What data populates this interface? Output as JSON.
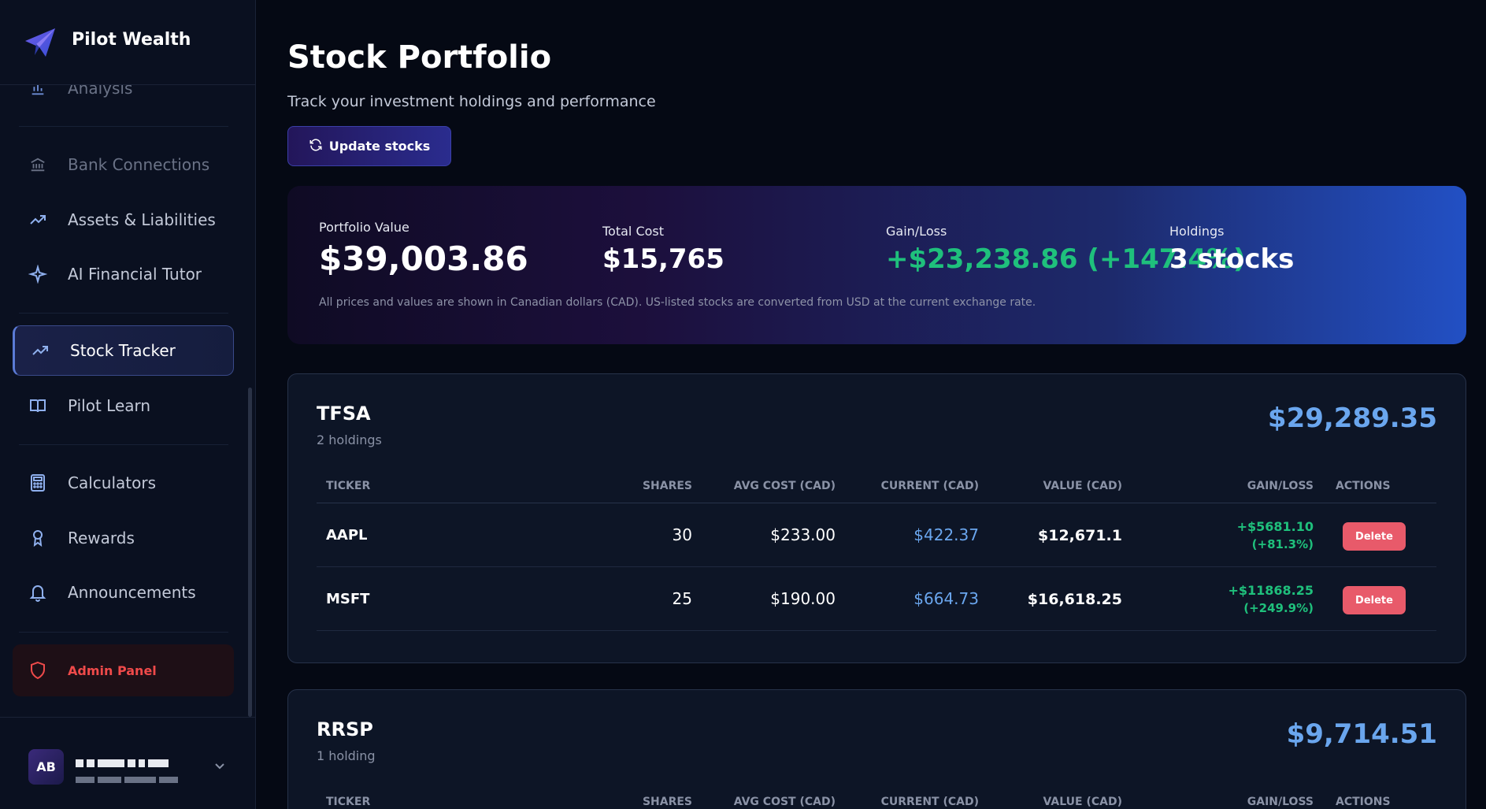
{
  "brand": {
    "name": "Pilot Wealth"
  },
  "sidebar": {
    "items": [
      {
        "label": "Analysis",
        "icon": "bar-chart-icon"
      },
      {
        "label": "Bank Connections",
        "icon": "bank-icon"
      },
      {
        "label": "Assets & Liabilities",
        "icon": "trending-up-icon"
      },
      {
        "label": "AI Financial Tutor",
        "icon": "sparkle-icon"
      },
      {
        "label": "Stock Tracker",
        "icon": "trending-up-icon"
      },
      {
        "label": "Pilot Learn",
        "icon": "book-icon"
      },
      {
        "label": "Calculators",
        "icon": "calculator-icon"
      },
      {
        "label": "Rewards",
        "icon": "award-icon"
      },
      {
        "label": "Announcements",
        "icon": "bell-icon"
      },
      {
        "label": "Admin Panel",
        "icon": "shield-icon"
      }
    ],
    "user": {
      "initials": "AB"
    }
  },
  "header": {
    "title": "Stock Portfolio",
    "subtitle": "Track your investment holdings and performance",
    "update_label": "Update stocks"
  },
  "summary": {
    "portfolio_value_label": "Portfolio Value",
    "portfolio_value": "$39,003.86",
    "total_cost_label": "Total Cost",
    "total_cost": "$15,765",
    "gain_loss_label": "Gain/Loss",
    "gain_loss": "+$23,238.86 (+147.4%)",
    "holdings_label": "Holdings",
    "holdings": "3 stocks",
    "note": "All prices and values are shown in Canadian dollars (CAD). US-listed stocks are converted from USD at the current exchange rate."
  },
  "columns": [
    "TICKER",
    "SHARES",
    "AVG COST (CAD)",
    "CURRENT (CAD)",
    "VALUE (CAD)",
    "GAIN/LOSS",
    "ACTIONS"
  ],
  "accounts": [
    {
      "name": "TFSA",
      "count": "2 holdings",
      "total": "$29,289.35",
      "rows": [
        {
          "ticker": "AAPL",
          "shares": "30",
          "avg_cost": "$233.00",
          "current": "$422.37",
          "value": "$12,671.1",
          "gain": "+$5681.10",
          "gain_pct": "(+81.3%)",
          "action": "Delete"
        },
        {
          "ticker": "MSFT",
          "shares": "25",
          "avg_cost": "$190.00",
          "current": "$664.73",
          "value": "$16,618.25",
          "gain": "+$11868.25",
          "gain_pct": "(+249.9%)",
          "action": "Delete"
        }
      ]
    },
    {
      "name": "RRSP",
      "count": "1 holding",
      "total": "$9,714.51"
    }
  ]
}
